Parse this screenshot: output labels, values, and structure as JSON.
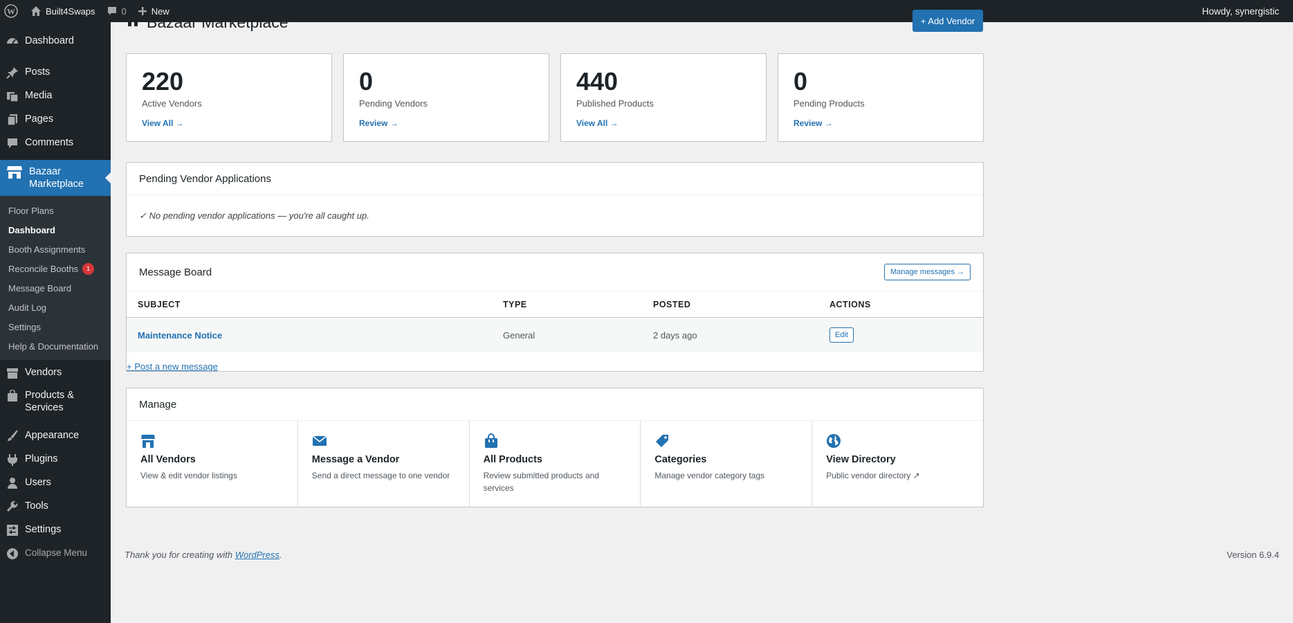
{
  "adminbar": {
    "site_name": "Built4Swaps",
    "comments_count": "0",
    "new_label": "New",
    "howdy": "Howdy, synergistic"
  },
  "sidebar": {
    "top_items": [
      {
        "label": "Dashboard",
        "icon": "dashboard-icon"
      },
      {
        "label": "Posts",
        "icon": "pin-icon"
      },
      {
        "label": "Media",
        "icon": "media-icon"
      },
      {
        "label": "Pages",
        "icon": "pages-icon"
      },
      {
        "label": "Comments",
        "icon": "comments-icon"
      }
    ],
    "current": {
      "label_line1": "Bazaar",
      "label_line2": "Marketplace",
      "icon": "store-icon"
    },
    "submenu": [
      {
        "label": "Floor Plans"
      },
      {
        "label": "Dashboard"
      },
      {
        "label": "Booth Assignments"
      },
      {
        "label": "Reconcile Booths",
        "badge": "1"
      },
      {
        "label": "Message Board"
      },
      {
        "label": "Audit Log"
      },
      {
        "label": "Settings"
      },
      {
        "label": "Help & Documentation"
      }
    ],
    "bottom_items": [
      {
        "label": "Vendors"
      },
      {
        "label_line1": "Products &",
        "label_line2": "Services"
      },
      {
        "label": "Appearance"
      },
      {
        "label": "Plugins"
      },
      {
        "label": "Users"
      },
      {
        "label": "Tools"
      },
      {
        "label": "Settings"
      },
      {
        "label": "Collapse Menu"
      }
    ]
  },
  "header": {
    "title": "Bazaar Marketplace",
    "add_vendor": "+ Add Vendor"
  },
  "stats": [
    {
      "number": "220",
      "label": "Active Vendors",
      "link": "View All →"
    },
    {
      "number": "0",
      "label": "Pending Vendors",
      "link": "Review →"
    },
    {
      "number": "440",
      "label": "Published Products",
      "link": "View All →"
    },
    {
      "number": "0",
      "label": "Pending Products",
      "link": "Review →"
    }
  ],
  "pending": {
    "title": "Pending Vendor Applications",
    "message": "✓ No pending vendor applications — you're all caught up."
  },
  "message_board": {
    "title": "Message Board",
    "manage_button": "Manage messages →",
    "columns": [
      "SUBJECT",
      "TYPE",
      "POSTED",
      "ACTIONS"
    ],
    "rows": [
      {
        "subject": "Maintenance Notice",
        "type": "General",
        "posted": "2 days ago",
        "action": "Edit"
      }
    ],
    "post_new": "+ Post a new message"
  },
  "manage": {
    "title": "Manage",
    "items": [
      {
        "title": "All Vendors",
        "desc": "View & edit vendor listings",
        "icon": "store-icon"
      },
      {
        "title": "Message a Vendor",
        "desc": "Send a direct message to one vendor",
        "icon": "envelope-icon"
      },
      {
        "title": "All Products",
        "desc": "Review submitted products and services",
        "icon": "bag-icon"
      },
      {
        "title": "Categories",
        "desc": "Manage vendor category tags",
        "icon": "tag-icon"
      },
      {
        "title": "View Directory",
        "desc": "Public vendor directory ↗",
        "icon": "globe-icon"
      }
    ]
  },
  "footer": {
    "thanks_prefix": "Thank you for creating with ",
    "wp_link": "WordPress",
    "thanks_suffix": ".",
    "version": "Version 6.9.4"
  },
  "colors": {
    "accent": "#2271b1",
    "sidebar_bg": "#1d2327",
    "badge": "#d63638"
  }
}
